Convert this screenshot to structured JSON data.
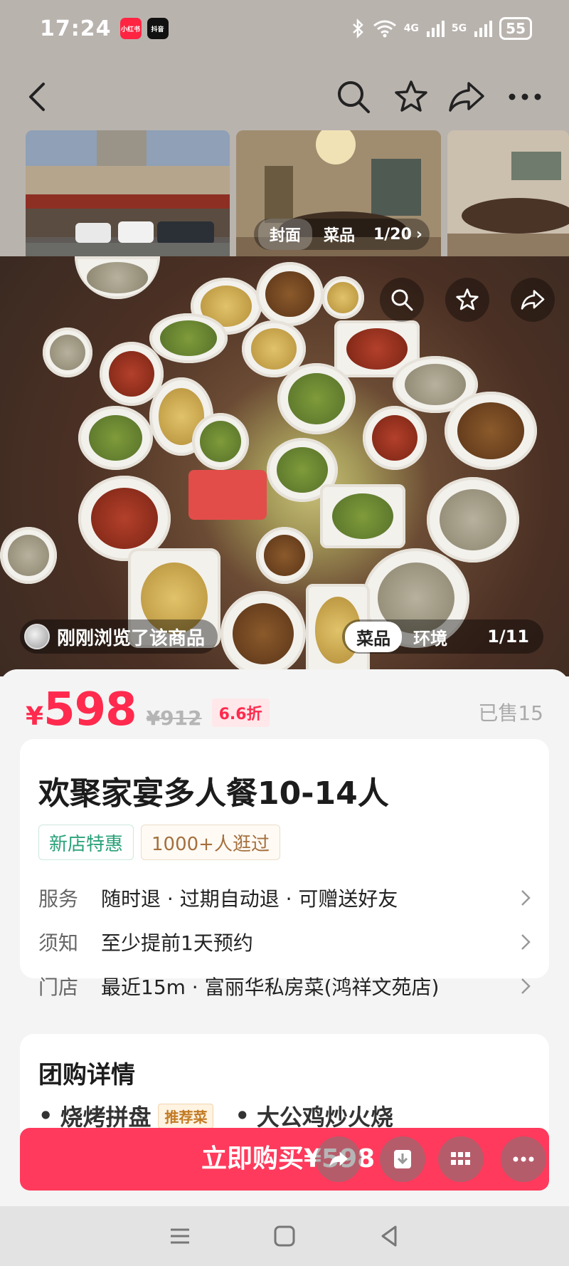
{
  "status_bar": {
    "time": "17:24",
    "app_badge_1": "小红书",
    "app_badge_2": "抖音",
    "signal_1": "4G",
    "signal_2": "5G",
    "battery": "55"
  },
  "nav": {
    "icons": [
      "back-icon",
      "search-icon",
      "star-icon",
      "share-icon",
      "more-icon"
    ]
  },
  "thumb_gallery": {
    "tabs": [
      "封面",
      "菜品"
    ],
    "active_tab": "封面",
    "counter": "1/20"
  },
  "photo_gallery": {
    "browse_text": "刚刚浏览了该商品",
    "tabs": [
      "菜品",
      "环境"
    ],
    "active_tab": "菜品",
    "counter": "1/11"
  },
  "price": {
    "currency": "¥",
    "value": "598",
    "original": "¥912",
    "discount": "6.6折",
    "sold": "已售15"
  },
  "product": {
    "title": "欢聚家宴多人餐10-14人",
    "tags": [
      "新店特惠",
      "1000+人逛过"
    ],
    "rows": [
      {
        "label": "服务",
        "value": "随时退 · 过期自动退 · 可赠送好友"
      },
      {
        "label": "须知",
        "value": "至少提前1天预约"
      },
      {
        "label": "门店",
        "value": "最近15m · 富丽华私房菜(鸿祥文苑店)"
      }
    ]
  },
  "details": {
    "heading": "团购详情",
    "peek_item_1": "烧烤拼盘",
    "peek_badge": "推荐菜",
    "peek_item_2": "大公鸡炒火烧"
  },
  "buy_bar": {
    "label": "立即购买¥598"
  },
  "colors": {
    "accent": "#ff2a4d",
    "buy_button": "#ff3a5c",
    "tag_green": "#2aa17a",
    "tag_brown": "#a4703e"
  }
}
